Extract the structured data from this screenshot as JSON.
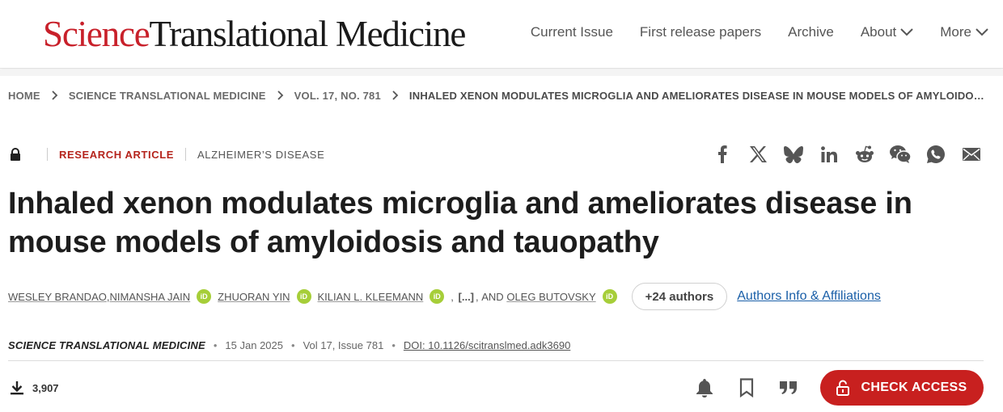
{
  "header": {
    "logo_brand": "Science",
    "logo_rest": "Translational Medicine",
    "nav": [
      {
        "label": "Current Issue",
        "icon": ""
      },
      {
        "label": "First release papers",
        "icon": ""
      },
      {
        "label": "Archive",
        "icon": ""
      },
      {
        "label": "About",
        "icon": "chevron-down-icon"
      },
      {
        "label": "More",
        "icon": "chevron-down-icon"
      }
    ]
  },
  "breadcrumb": [
    "HOME",
    "SCIENCE TRANSLATIONAL MEDICINE",
    "VOL. 17, NO. 781",
    "INHALED XENON MODULATES MICROGLIA AND AMELIORATES DISEASE IN MOUSE MODELS OF AMYLOIDOS…"
  ],
  "article": {
    "type": "RESEARCH ARTICLE",
    "subject": "ALZHEIMER’S DISEASE",
    "title": "Inhaled xenon modulates microglia and ameliorates disease in mouse models of amyloidosis and tauopathy",
    "authors": [
      {
        "name": "WESLEY BRANDAO",
        "orcid": false,
        "sep": ", "
      },
      {
        "name": "NIMANSHA JAIN",
        "orcid": true,
        "sep": ""
      },
      {
        "name": "ZHUORAN YIN",
        "orcid": true,
        "sep": ""
      },
      {
        "name": "KILIAN L. KLEEMANN",
        "orcid": true,
        "sep": ""
      }
    ],
    "authors_ellipsis": "[...]",
    "authors_and": "AND",
    "last_author": "OLEG BUTOVSKY",
    "more_authors": "+24 authors",
    "affiliations_link": "Authors Info & Affiliations",
    "journal": "SCIENCE TRANSLATIONAL MEDICINE",
    "date": "15 Jan 2025",
    "volume": "Vol 17, Issue 781",
    "doi": "DOI: 10.1126/scitranslmed.adk3690",
    "downloads": "3,907"
  },
  "share_icons": [
    "facebook-icon",
    "x-icon",
    "bluesky-icon",
    "linkedin-icon",
    "reddit-icon",
    "wechat-icon",
    "whatsapp-icon",
    "email-icon"
  ],
  "actions": {
    "check_access": "CHECK ACCESS"
  },
  "colors": {
    "brand_red": "#c8202a",
    "access_button": "#c8201f",
    "link_blue": "#1a5fa8",
    "orcid_green": "#a6ce39"
  }
}
